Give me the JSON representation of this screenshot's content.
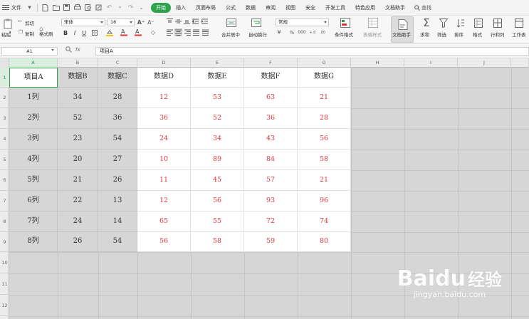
{
  "menubar": {
    "file_label": "文件",
    "tabs": [
      "开始",
      "插入",
      "页面布局",
      "公式",
      "数据",
      "审阅",
      "视图",
      "安全",
      "开发工具",
      "特色应用",
      "文档助手"
    ],
    "active_tab": 0,
    "search_label": "查找"
  },
  "ribbon": {
    "paste": "粘贴",
    "cut": "剪切",
    "copy": "复制",
    "format_painter": "格式刷",
    "font_name": "宋体",
    "font_size": "16",
    "merge_center": "合并居中",
    "wrap_text": "自动换行",
    "number_format": "常规",
    "cond_format": "条件格式",
    "table_style": "表格样式",
    "doc_assistant": "文档助手",
    "sum": "求和",
    "filter": "筛选",
    "sort": "排序",
    "format": "格式",
    "rows_cols": "行和列",
    "worksheet": "工作表"
  },
  "formula_bar": {
    "name_box": "A1",
    "fx": "fx",
    "content": "项目A"
  },
  "columns": [
    "A",
    "B",
    "C",
    "D",
    "E",
    "F",
    "G",
    "H",
    "I",
    "J"
  ],
  "rows": [
    "1",
    "2",
    "3",
    "4",
    "5",
    "6",
    "7",
    "8",
    "9",
    "10",
    "11",
    "12"
  ],
  "sheet": {
    "header": [
      "项目A",
      "数据B",
      "数据C",
      "数据D",
      "数据E",
      "数据F",
      "数据G"
    ],
    "data": [
      [
        "1列",
        "34",
        "28",
        "12",
        "53",
        "63",
        "21"
      ],
      [
        "2列",
        "52",
        "36",
        "36",
        "52",
        "36",
        "28"
      ],
      [
        "3列",
        "23",
        "54",
        "24",
        "34",
        "43",
        "56"
      ],
      [
        "4列",
        "20",
        "27",
        "10",
        "89",
        "84",
        "58"
      ],
      [
        "5列",
        "21",
        "26",
        "11",
        "45",
        "57",
        "21"
      ],
      [
        "6列",
        "22",
        "13",
        "12",
        "56",
        "93",
        "96"
      ],
      [
        "7列",
        "24",
        "14",
        "65",
        "55",
        "72",
        "74"
      ],
      [
        "8列",
        "26",
        "54",
        "56",
        "58",
        "59",
        "80"
      ]
    ]
  },
  "colors": {
    "accent": "#2fa34c",
    "red_text": "#e0353c",
    "gray_fill": "#d6d6d6"
  },
  "watermark": {
    "logo": "Baidu",
    "logo_cn": "经验",
    "url": "jingyan.baidu.com"
  }
}
